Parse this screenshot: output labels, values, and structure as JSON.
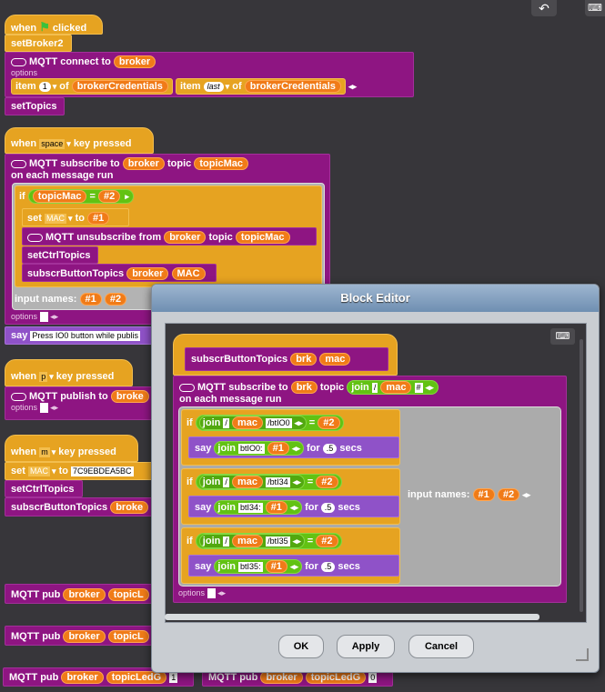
{
  "toolbar": {
    "undo_icon": "undo-arrow",
    "keyboard_icon": "keyboard"
  },
  "script1": {
    "hat_when": "when",
    "hat_clicked": "clicked",
    "set_broker": "setBroker2",
    "mqtt_connect": "MQTT connect to",
    "broker": "broker",
    "options": "options",
    "item": "item",
    "item_index": "1",
    "of": "of",
    "broker_credentials": "brokerCredentials",
    "item2": "item",
    "last": "last",
    "of2": "of",
    "broker_credentials2": "brokerCredentials",
    "set_topics": "setTopics"
  },
  "script2": {
    "when": "when",
    "key": "space",
    "key_pressed": "key pressed",
    "mqtt_subscribe": "MQTT subscribe to",
    "broker": "broker",
    "topic": "topic",
    "topicMac": "topicMac",
    "on_each": "on each message run",
    "if": "if",
    "topic_mac": "topicMac",
    "eq": "=",
    "hash2": "#2",
    "set": "set",
    "mac_var": "MAC",
    "to": "to",
    "hash1": "#1",
    "mqtt_unsub": "MQTT unsubscribe from",
    "broker2": "broker",
    "topic2": "topic",
    "topicMac2": "topicMac",
    "set_ctrl": "setCtrlTopics",
    "subscr": "subscrButtonTopics",
    "broker3": "broker",
    "mac": "MAC",
    "input_names": "input names:",
    "in1": "#1",
    "in2": "#2",
    "options": "options",
    "say": "say",
    "say_text": "Press IO0 button while publis"
  },
  "script3": {
    "when": "when",
    "key": "p",
    "key_pressed": "key pressed",
    "mqtt_publish": "MQTT publish to",
    "broker": "broke",
    "options": "options"
  },
  "script4": {
    "when": "when",
    "key": "m",
    "key_pressed": "key pressed",
    "set": "set",
    "mac_var": "MAC",
    "to": "to",
    "mac_value": "7C9EBDEA5BC",
    "set_ctrl": "setCtrlTopics",
    "subscr": "subscrButtonTopics",
    "broker": "broke"
  },
  "pubs": [
    {
      "label": "MQTT pub",
      "broker": "broker",
      "topic": "topicL"
    },
    {
      "label": "MQTT pub",
      "broker": "broker",
      "topic": "topicL"
    },
    {
      "label": "MQTT pub",
      "broker": "broker",
      "topic": "topicLedG",
      "value": "1"
    },
    {
      "label": "MQTT pub",
      "broker": "broker",
      "topic": "topicLedG",
      "value": "0"
    }
  ],
  "dialog": {
    "title": "Block Editor",
    "hat_name": "subscrButtonTopics",
    "p1": "brk",
    "p2": "mac",
    "subscribe": "MQTT subscribe to",
    "brk": "brk",
    "topic": "topic",
    "join": "join",
    "slash": "/",
    "mac": "mac",
    "hashsym": "#",
    "on_each": "on each message run",
    "rows": [
      {
        "if": "if",
        "join": "join",
        "slash": "/",
        "mac": "mac",
        "suffix": "/btIO0",
        "eq": "=",
        "hash": "#2",
        "say": "say",
        "join2": "join",
        "prefix": "btIO0:",
        "hash1": "#1",
        "for": "for",
        "secs_val": ".5",
        "secs": "secs"
      },
      {
        "if": "if",
        "join": "join",
        "slash": "/",
        "mac": "mac",
        "suffix": "/btI34",
        "eq": "=",
        "hash": "#2",
        "say": "say",
        "join2": "join",
        "prefix": "btI34:",
        "hash1": "#1",
        "for": "for",
        "secs_val": ".5",
        "secs": "secs"
      },
      {
        "if": "if",
        "join": "join",
        "slash": "/",
        "mac": "mac",
        "suffix": "/btI35",
        "eq": "=",
        "hash": "#2",
        "say": "say",
        "join2": "join",
        "prefix": "btI35:",
        "hash1": "#1",
        "for": "for",
        "secs_val": ".5",
        "secs": "secs"
      }
    ],
    "input_names": "input names:",
    "in1": "#1",
    "in2": "#2",
    "options": "options",
    "ok": "OK",
    "apply": "Apply",
    "cancel": "Cancel"
  }
}
